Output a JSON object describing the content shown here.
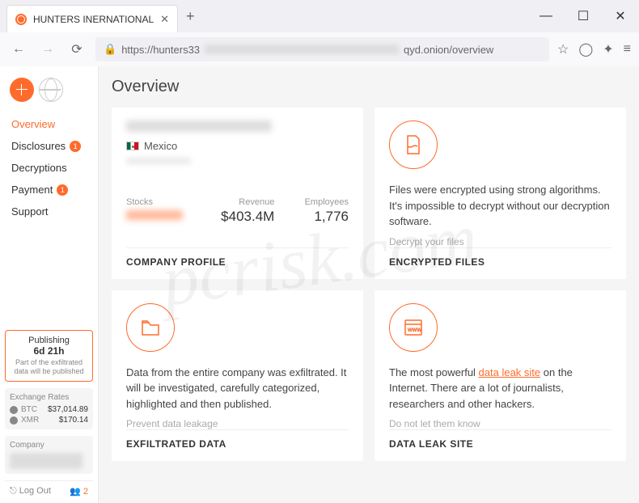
{
  "browser": {
    "tab_title": "HUNTERS INERNATIONAL",
    "url_prefix": "https://hunters33",
    "url_suffix": "qyd.onion/overview"
  },
  "sidebar": {
    "items": [
      {
        "label": "Overview",
        "active": true
      },
      {
        "label": "Disclosures",
        "badge": "1"
      },
      {
        "label": "Decryptions"
      },
      {
        "label": "Payment",
        "badge": "1"
      },
      {
        "label": "Support"
      }
    ],
    "publishing": {
      "title": "Publishing",
      "time": "6d 21h",
      "note": "Part of the exfiltrated data will be published"
    },
    "rates": {
      "title": "Exchange Rates",
      "rows": [
        {
          "symbol": "BTC",
          "value": "$37,014.89"
        },
        {
          "symbol": "XMR",
          "value": "$170.14"
        }
      ]
    },
    "company_label": "Company",
    "logout": "Log Out",
    "users_count": "2"
  },
  "page": {
    "title": "Overview"
  },
  "cards": {
    "profile": {
      "country": "Mexico",
      "stats": {
        "stocks_label": "Stocks",
        "revenue_label": "Revenue",
        "revenue_value": "$403.4M",
        "employees_label": "Employees",
        "employees_value": "1,776"
      },
      "footer": "COMPANY PROFILE"
    },
    "encrypted": {
      "text": "Files were encrypted using strong algorithms. It's impossible to decrypt without our decryption software.",
      "sub": "Decrypt your files",
      "footer": "ENCRYPTED FILES"
    },
    "exfil": {
      "text": "Data from the entire company was exfiltrated. It will be investigated, carefully categorized, highlighted and then published.",
      "sub": "Prevent data leakage",
      "footer": "EXFILTRATED DATA"
    },
    "leak": {
      "text_before": "The most powerful ",
      "link": "data leak site",
      "text_after": " on the Internet. There are a lot of journalists, researchers and other hackers.",
      "sub": "Do not let them know",
      "footer": "DATA LEAK SITE"
    }
  },
  "watermark": "pcrisk.com"
}
